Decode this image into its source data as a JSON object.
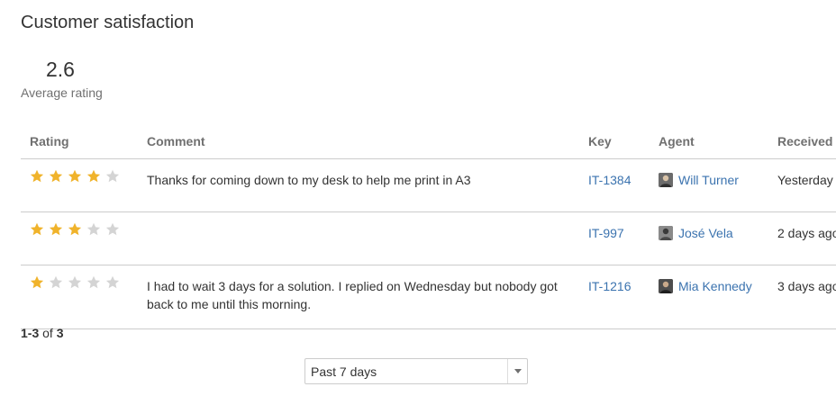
{
  "page": {
    "title": "Customer satisfaction"
  },
  "summary": {
    "average_value": "2.6",
    "average_label": "Average rating"
  },
  "table": {
    "columns": {
      "rating": "Rating",
      "comment": "Comment",
      "key": "Key",
      "agent": "Agent",
      "received": "Received"
    },
    "star_colors": {
      "filled": "#f0b32b",
      "empty": "#d4d4d4"
    },
    "rows": [
      {
        "rating": 4,
        "rating_max": 5,
        "comment": "Thanks for coming down to my desk to help me print in A3",
        "key": "IT-1384",
        "agent": "Will Turner",
        "agent_avatar": "avatar-icon",
        "received": "Yesterday"
      },
      {
        "rating": 3,
        "rating_max": 5,
        "comment": "",
        "key": "IT-997",
        "agent": "José Vela",
        "agent_avatar": "avatar-icon",
        "received": "2 days ago"
      },
      {
        "rating": 1,
        "rating_max": 5,
        "comment": "I had to wait 3 days for a solution. I replied on Wednesday but nobody got back to me until this morning.",
        "key": "IT-1216",
        "agent": "Mia Kennedy",
        "agent_avatar": "avatar-icon",
        "received": "3 days ago"
      }
    ]
  },
  "pager": {
    "range": "1-3",
    "of_label": "of",
    "total": "3"
  },
  "filter": {
    "selected": "Past 7 days",
    "icon": "chevron-down-icon"
  }
}
